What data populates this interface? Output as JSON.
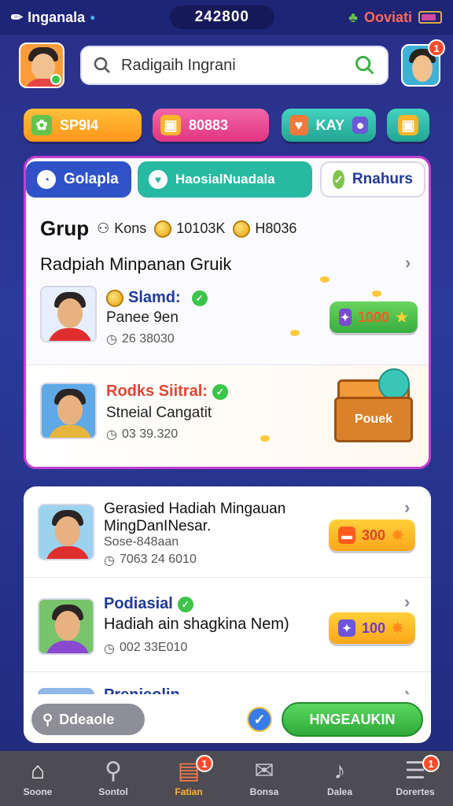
{
  "status": {
    "app_name": "Inganala",
    "center_value": "242800",
    "right_label": "Ooviati"
  },
  "header": {
    "search_placeholder": "Radigaih Ingrani",
    "profile_badge": "1"
  },
  "pills": [
    {
      "label": "SP9I4",
      "color": "#ffa51e"
    },
    {
      "label": "80883",
      "color": "#ef3a8a"
    },
    {
      "label": "KAY",
      "color": "#2fb6a5"
    },
    {
      "label": "",
      "color": "#2fb6a5"
    }
  ],
  "tabs": [
    {
      "label": "Golapla",
      "active": true
    },
    {
      "label": "HaosialNuadala",
      "active": false
    },
    {
      "label": "Rnahurs",
      "active": false
    }
  ],
  "group": {
    "title": "Grup",
    "meta_a": "Kons",
    "meta_b": "10103K",
    "meta_c": "H8036",
    "subtitle": "Radpiah Minpanan Gruik"
  },
  "featured": [
    {
      "name": "Slamd:",
      "sub": "Panee 9en",
      "time": "26 38030",
      "reward": "1000"
    },
    {
      "name": "Rodks Siitral:",
      "sub": "Stneial Cangatit",
      "time": "03 39.320",
      "chest_label": "Pouek"
    }
  ],
  "list": [
    {
      "title": "Gerasied Hadiah Mingauan",
      "line2": "MingDanINesar.",
      "line3": "Sose-848aan",
      "time": "7063 24 6010",
      "reward": "300"
    },
    {
      "title": "Podiasial",
      "line2": "Hadiah ain shagkina Nem)",
      "time": "002 33E010",
      "reward": "100"
    },
    {
      "title": "Prenieolin",
      "line2": "",
      "time": "",
      "reward": ""
    }
  ],
  "actions": {
    "secondary": "Ddeaole",
    "primary": "HNGEAUKIN"
  },
  "nav": [
    {
      "label": "Soone",
      "icon": "home-icon"
    },
    {
      "label": "Sontol",
      "icon": "search-icon"
    },
    {
      "label": "Fatian",
      "icon": "inbox-icon",
      "badge": "1"
    },
    {
      "label": "Bonsa",
      "icon": "mail-icon"
    },
    {
      "label": "Dalea",
      "icon": "bell-icon"
    },
    {
      "label": "Dorertes",
      "icon": "menu-icon",
      "badge": "1"
    }
  ]
}
